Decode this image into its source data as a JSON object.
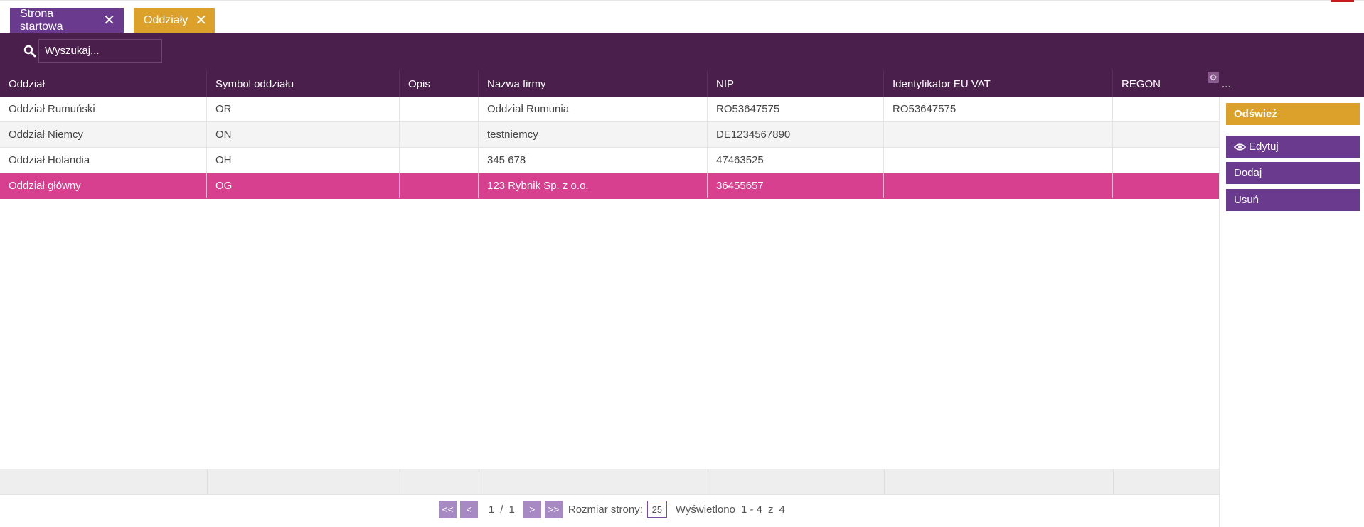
{
  "tabs": [
    {
      "label": "Strona startowa",
      "close": "✕"
    },
    {
      "label": "Oddziały",
      "close": "✕"
    }
  ],
  "search": {
    "placeholder": "Wyszukaj..."
  },
  "table": {
    "columns": [
      "Oddział",
      "Symbol oddziału",
      "Opis",
      "Nazwa firmy",
      "NIP",
      "Identyfikator EU VAT",
      "REGON"
    ],
    "more": "...",
    "rows": [
      [
        "Oddział Rumuński",
        "OR",
        "",
        "Oddział Rumunia",
        "RO53647575",
        "RO53647575",
        ""
      ],
      [
        "Oddział Niemcy",
        "ON",
        "",
        "testniemcy",
        "DE1234567890",
        "",
        ""
      ],
      [
        "Oddział Holandia",
        "OH",
        "",
        "345 678",
        "47463525",
        "",
        ""
      ],
      [
        "Oddział główny",
        "OG",
        "",
        "123 Rybnik Sp. z o.o.",
        "36455657",
        "",
        ""
      ]
    ],
    "selected_row": 3
  },
  "pager": {
    "first": "<<",
    "prev": "<",
    "next": ">",
    "last": ">>",
    "current": "1",
    "separator": "/",
    "total": "1",
    "size_label": "Rozmiar strony:",
    "size": "25",
    "shown_label": "Wyświetlono",
    "shown_range": "1 - 4",
    "of_label": "z",
    "shown_total": "4"
  },
  "actions": {
    "refresh": "Odśwież",
    "edit": "Edytuj",
    "add": "Dodaj",
    "delete": "Usuń"
  },
  "colors": {
    "header_bg": "#4a1f4b",
    "accent_gold": "#dca12a",
    "accent_purple": "#6a3a8e",
    "selected_row": "#d6408f"
  }
}
